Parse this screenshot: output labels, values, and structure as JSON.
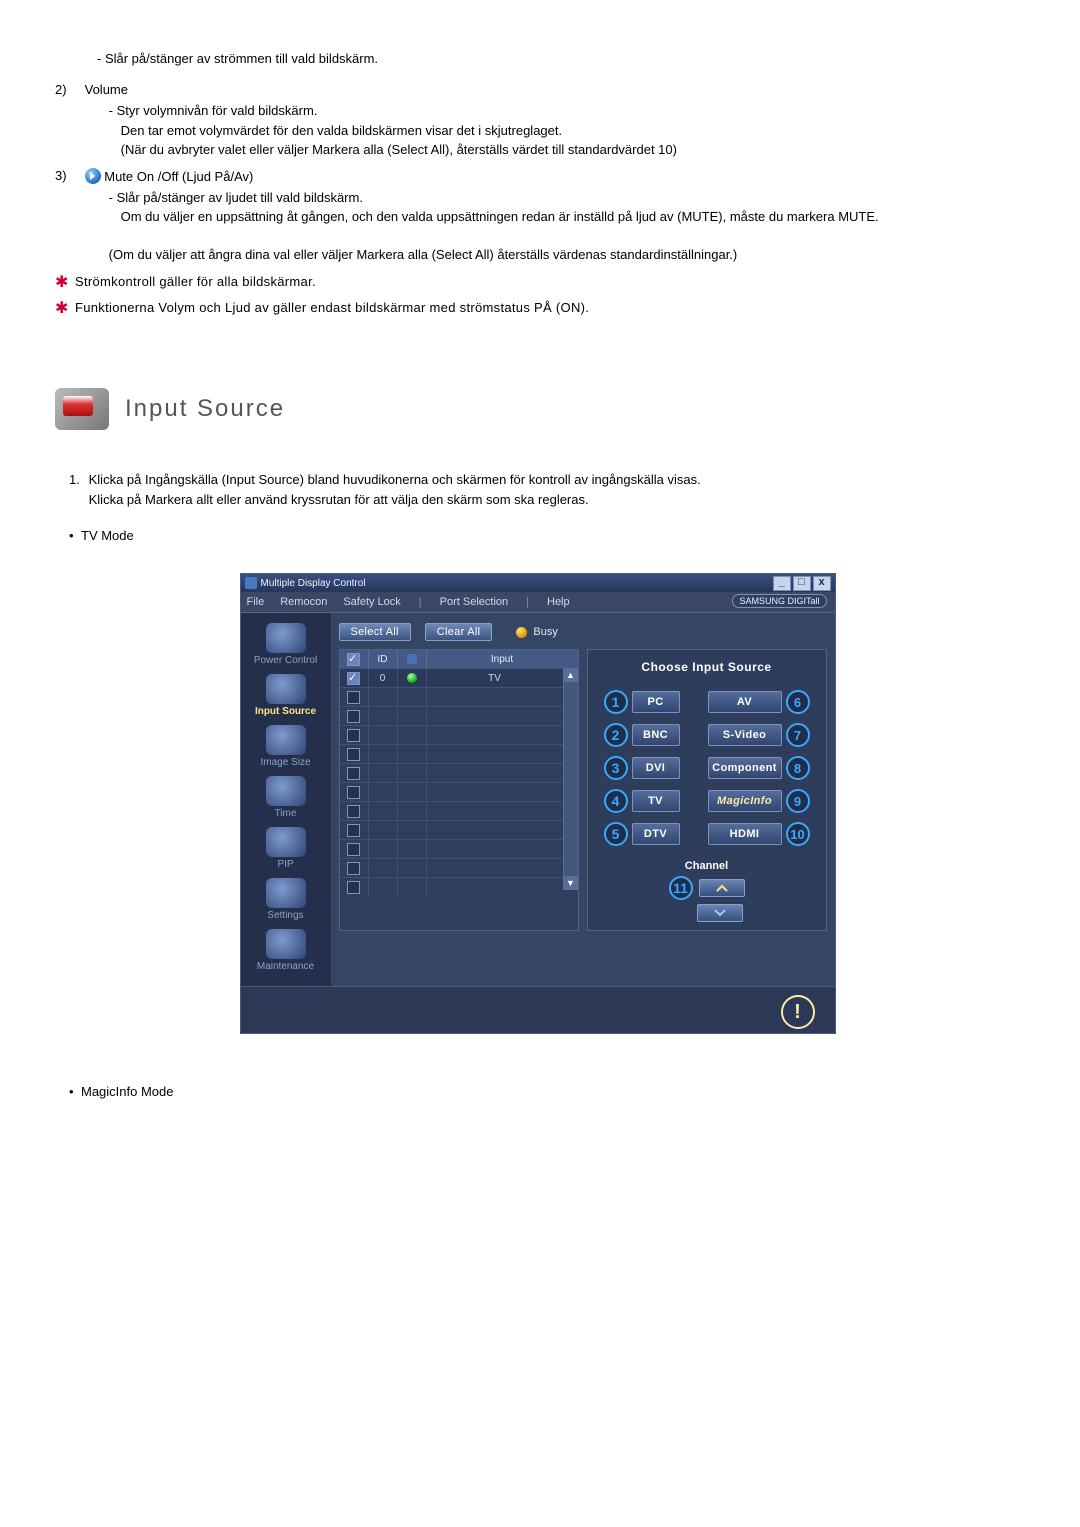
{
  "text_intro_dash": "- Slår på/stänger av strömmen till vald bildskärm.",
  "item2": {
    "num": "2)",
    "title": "Volume",
    "dash1": "- Styr volymnivån för vald bildskärm.",
    "line2": "Den tar emot volymvärdet för den valda bildskärmen visar det i skjutreglaget.",
    "line3": "(När du avbryter valet eller väljer Markera alla (Select All), återställs värdet till standardvärdet 10)"
  },
  "item3": {
    "num": "3)",
    "title": "Mute On /Off (Ljud På/Av)",
    "dash1": "- Slår på/stänger av ljudet till vald bildskärm.",
    "line2": "Om du väljer en uppsättning åt gången, och den valda uppsättningen redan är inställd på ljud av (MUTE), måste du markera MUTE.",
    "line3": "(Om du väljer att ångra dina val eller väljer Markera alla (Select All) återställs värdenas standardinställningar.)"
  },
  "star1": "Strömkontroll gäller för alla bildskärmar.",
  "star2": "Funktionerna Volym och Ljud av gäller endast bildskärmar med strömstatus PÅ (ON).",
  "section_title": "Input Source",
  "para1_num": "1.",
  "para1_line1": "Klicka på Ingångskälla (Input Source) bland huvudikonerna och skärmen för kontroll av ingångskälla visas.",
  "para1_line2": "Klicka på Markera allt eller använd kryssrutan för att välja den skärm som ska regleras.",
  "mode_tv": "TV Mode",
  "mode_magic": "MagicInfo Mode",
  "window": {
    "title": "Multiple Display Control",
    "min": "_",
    "max": "□",
    "close": "x",
    "menu": {
      "file": "File",
      "remocon": "Remocon",
      "safety": "Safety Lock",
      "port": "Port Selection",
      "help": "Help"
    },
    "brand": "SAMSUNG DIGITall",
    "sidebar": {
      "power": "Power Control",
      "input": "Input Source",
      "image": "Image Size",
      "time": "Time",
      "pip": "PIP",
      "settings": "Settings",
      "maintenance": "Maintenance"
    },
    "top": {
      "select_all": "Select All",
      "clear_all": "Clear All",
      "busy": "Busy"
    },
    "list": {
      "hd_cb": "✓",
      "hd_id": "ID",
      "hd_st": "",
      "hd_in": "Input",
      "row0_id": "0",
      "row0_in": "TV"
    },
    "right": {
      "choose": "Choose Input Source",
      "pc": "PC",
      "av": "AV",
      "bnc": "BNC",
      "svideo": "S-Video",
      "dvi": "DVI",
      "component": "Component",
      "tv": "TV",
      "magicinfo": "MagicInfo",
      "dtv": "DTV",
      "hdmi": "HDMI",
      "channel": "Channel",
      "c1": "1",
      "c2": "2",
      "c3": "3",
      "c4": "4",
      "c5": "5",
      "c6": "6",
      "c7": "7",
      "c8": "8",
      "c9": "9",
      "c10": "10",
      "c11": "11"
    }
  }
}
